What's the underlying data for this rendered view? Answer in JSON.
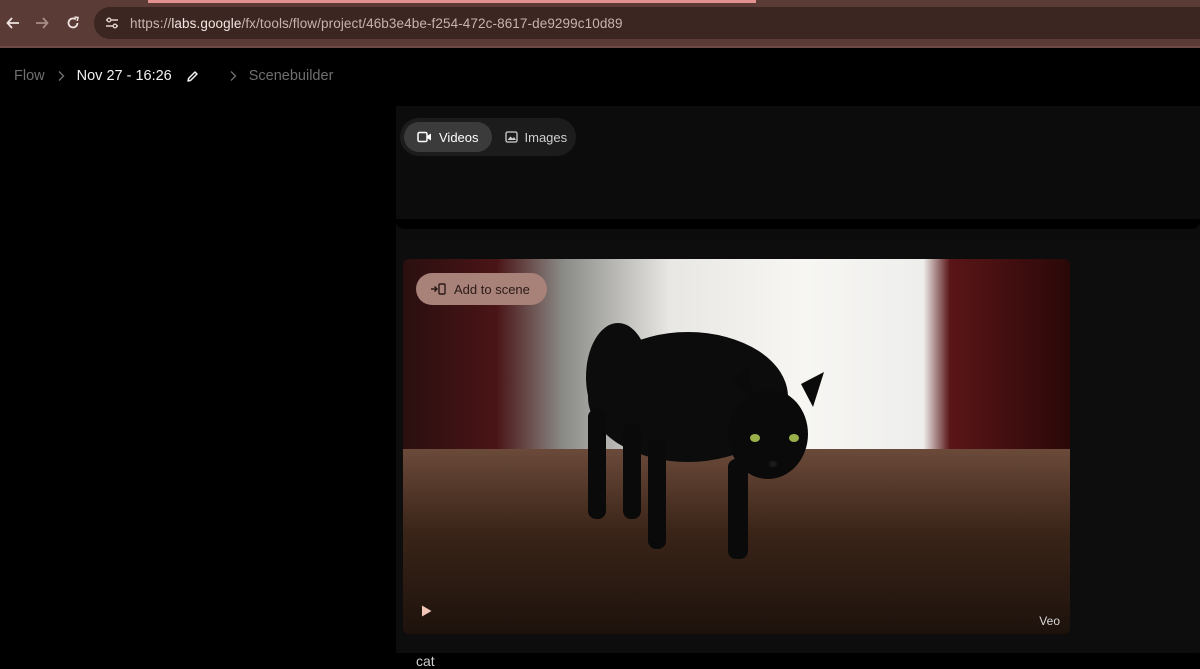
{
  "browser": {
    "back_icon": "arrow-left-icon",
    "forward_icon": "arrow-right-icon",
    "reload_icon": "reload-icon",
    "site_info_icon": "tune-icon",
    "url_prefix": "https://",
    "url_domain": "labs.google",
    "url_path": "/fx/tools/flow/project/46b3e4be-f254-472c-8617-de9299c10d89"
  },
  "breadcrumb": {
    "root": "Flow",
    "project": "Nov 27 - 16:26",
    "edit_icon": "pencil-icon",
    "section": "Scenebuilder"
  },
  "toggle": {
    "videos_label": "Videos",
    "images_label": "Images",
    "selected": "Videos"
  },
  "card": {
    "add_label": "Add to scene",
    "badge": "Veo",
    "caption": "cat"
  },
  "colors": {
    "chrome": "#5a3b36",
    "omnibox": "#3b2622",
    "loading_bar": "#e29090",
    "add_button": "#a88178"
  }
}
